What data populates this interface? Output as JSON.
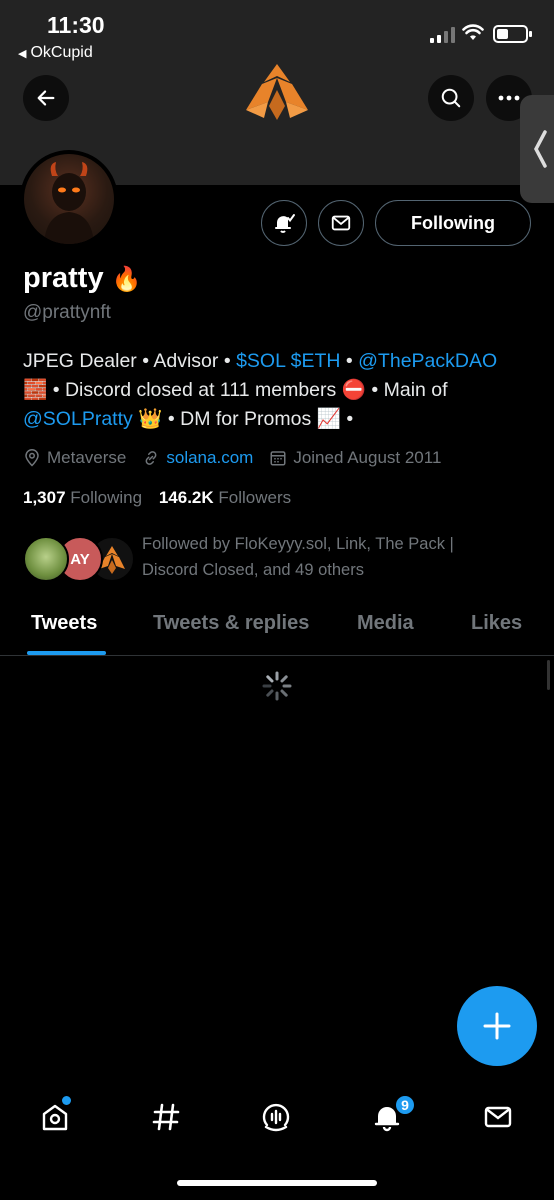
{
  "status_bar": {
    "time": "11:30",
    "back_app": "OkCupid"
  },
  "profile": {
    "name": "pratty",
    "name_emoji": "🔥",
    "handle": "@prattynft",
    "bio": {
      "line1_text": "JPEG Dealer • Advisor • ",
      "line1_tokens": "$SOL $ETH",
      "line1_sep": " • ",
      "line1_mention": "@ThePackDAO",
      "line2_emoji": "🧱",
      "line2_text": " • Discord closed at 111 members ",
      "line2_emoji2": "⛔",
      "line2_text2": " • Main of",
      "line3_mention": "@SOLPratty",
      "line3_emoji": " 👑",
      "line3_text": " • DM for Promos ",
      "line3_emoji2": "📈",
      "line3_text2": " •"
    },
    "location": "Metaverse",
    "website": "solana.com",
    "joined": "Joined August 2011",
    "following_count": "1,307",
    "following_label": "Following",
    "followers_count": "146.2K",
    "followers_label": "Followers",
    "followed_by": "Followed by FloKeyyy.sol, Link, The Pack | Discord Closed, and 49 others",
    "followed_avatar2_text": "AY"
  },
  "actions": {
    "following_button": "Following"
  },
  "tabs": [
    {
      "label": "Tweets",
      "active": true
    },
    {
      "label": "Tweets & replies",
      "active": false
    },
    {
      "label": "Media",
      "active": false
    },
    {
      "label": "Likes",
      "active": false
    }
  ],
  "bottom_nav": {
    "notifications_badge": "9"
  },
  "colors": {
    "accent": "#1d9bf0",
    "background": "#000000",
    "banner": "#232323",
    "secondary_text": "#71767b"
  },
  "icons": [
    "back-arrow-icon",
    "search-icon",
    "more-icon",
    "logo-icon",
    "bell-check-icon",
    "mail-icon",
    "location-icon",
    "link-icon",
    "calendar-icon",
    "spinner-icon",
    "plus-icon",
    "home-icon",
    "hashtag-icon",
    "spaces-icon",
    "bell-icon",
    "envelope-icon"
  ]
}
